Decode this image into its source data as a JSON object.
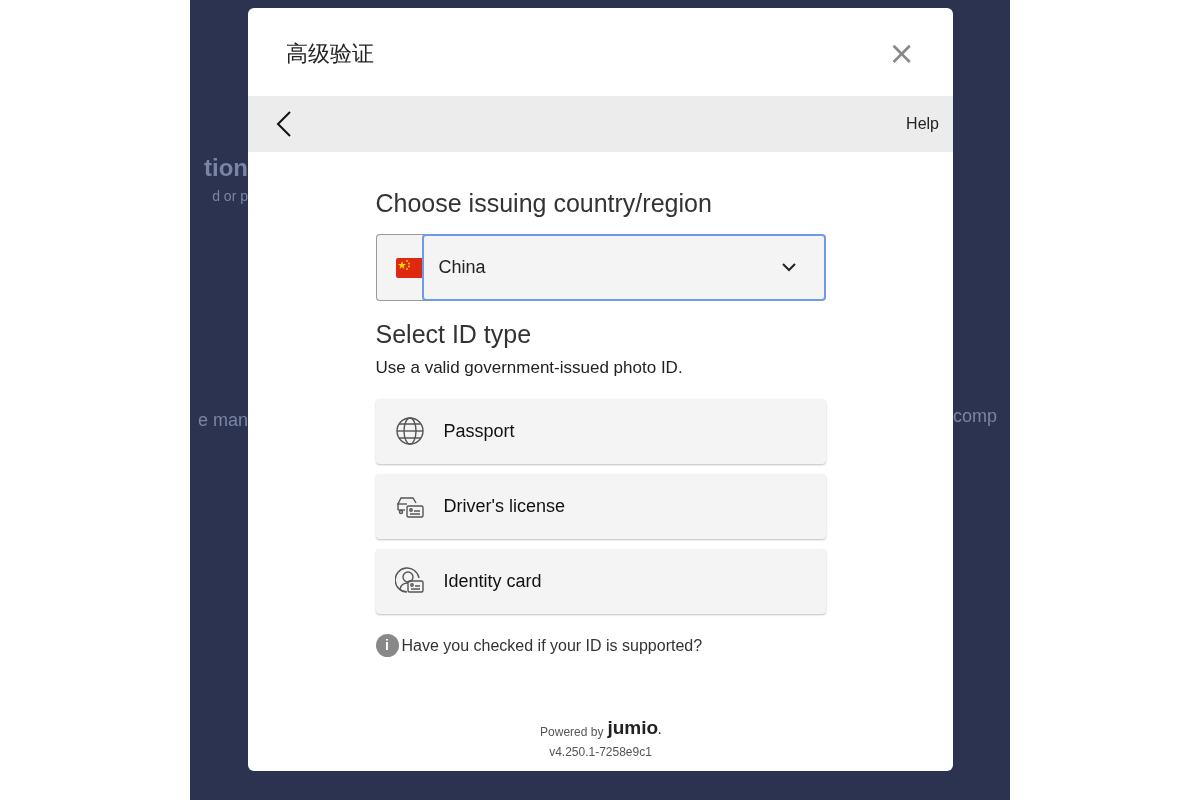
{
  "backdrop": {
    "left_fragments": [
      "tion",
      "d or p",
      "e man"
    ],
    "right_fragments": [
      "comp"
    ]
  },
  "dialog": {
    "title": "高级验证",
    "close": "×",
    "help": "Help"
  },
  "country": {
    "heading": "Choose issuing country/region",
    "value": "China",
    "focused": true
  },
  "id_type": {
    "heading": "Select ID type",
    "subtitle": "Use a valid government-issued photo ID.",
    "options": [
      {
        "kind": "passport",
        "label": "Passport"
      },
      {
        "kind": "license",
        "label": "Driver's license"
      },
      {
        "kind": "identity",
        "label": "Identity card"
      }
    ]
  },
  "info": {
    "icon": "i",
    "text": "Have you checked if your ID is supported?"
  },
  "footer": {
    "powered_by": "Powered by",
    "brand": "jumio",
    "brand_dot": ".",
    "version": "v4.250.1-7258e9c1"
  }
}
